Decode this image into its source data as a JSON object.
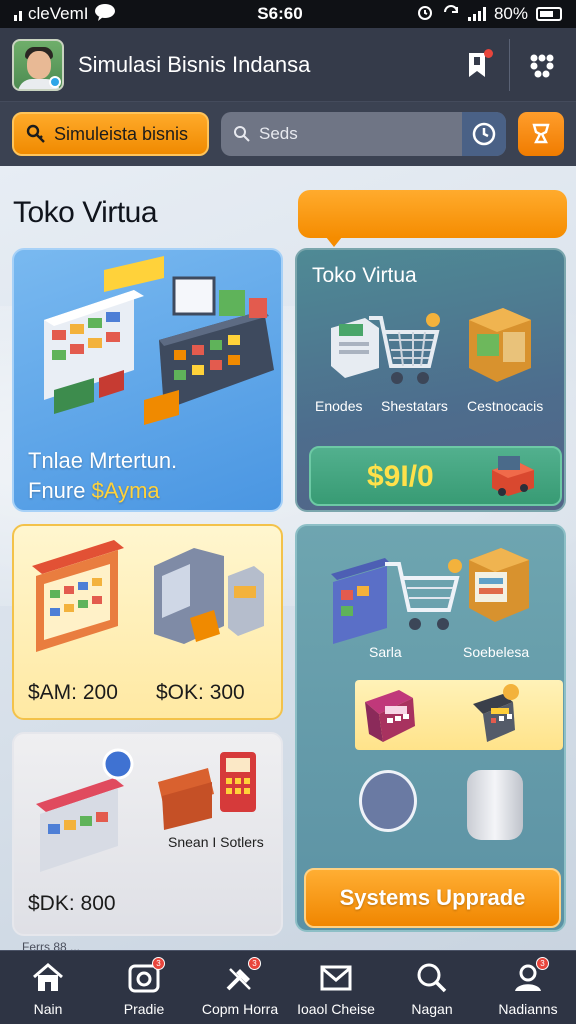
{
  "status_bar": {
    "carrier": "cleVemI",
    "time": "S6:60",
    "battery": "80%",
    "icons": [
      "signal-icon",
      "chat-icon",
      "alarm-icon",
      "battery-icon"
    ]
  },
  "app_bar": {
    "title": "Simulasi Bisnis Indansa",
    "icons": [
      "avatar",
      "bookmark-icon",
      "grid-menu-icon"
    ]
  },
  "toolbar": {
    "primary_button": "Simuleista bisnis",
    "search_placeholder": "Seds",
    "icons": [
      "key-icon",
      "search-icon",
      "clock-icon",
      "trophy-icon"
    ]
  },
  "main": {
    "section_title": "Toko Virtua",
    "cards": {
      "store_feature": {
        "line1": "Tnlae Mrtertun.",
        "line2_prefix": "Fnure ",
        "line2_highlight": "$Ayma"
      },
      "store_panel": {
        "title": "Toko Virtua",
        "labels": [
          "Enodes",
          "Shestatars",
          "Cestnocacis"
        ],
        "price": "$9I/0"
      },
      "offer_yellow": {
        "prices": [
          "$AM: 200",
          "$OK: 300"
        ]
      },
      "offer_grey": {
        "label": "Snean I Sotlers",
        "price": "$DK: 800"
      },
      "upgrade_panel": {
        "labels": [
          "Sarla",
          "Soebelesa"
        ],
        "button": "Systems Upprade"
      }
    },
    "partial_text": "Ferrs 88 ..."
  },
  "bottom_nav": [
    {
      "label": "Nain",
      "icon": "home-icon",
      "badge": ""
    },
    {
      "label": "Pradie",
      "icon": "camera-icon",
      "badge": "3"
    },
    {
      "label": "Copm Horra",
      "icon": "tools-icon",
      "badge": "3"
    },
    {
      "label": "Ioaol Cheise",
      "icon": "mail-icon",
      "badge": ""
    },
    {
      "label": "Nagan",
      "icon": "search-icon",
      "badge": ""
    },
    {
      "label": "Nadianns",
      "icon": "user-icon",
      "badge": "3"
    }
  ],
  "colors": {
    "accent_orange": "#f58c00",
    "header_bg": "#353b4a",
    "nav_bg": "#2e3444",
    "price_yellow": "#ffe14a"
  }
}
